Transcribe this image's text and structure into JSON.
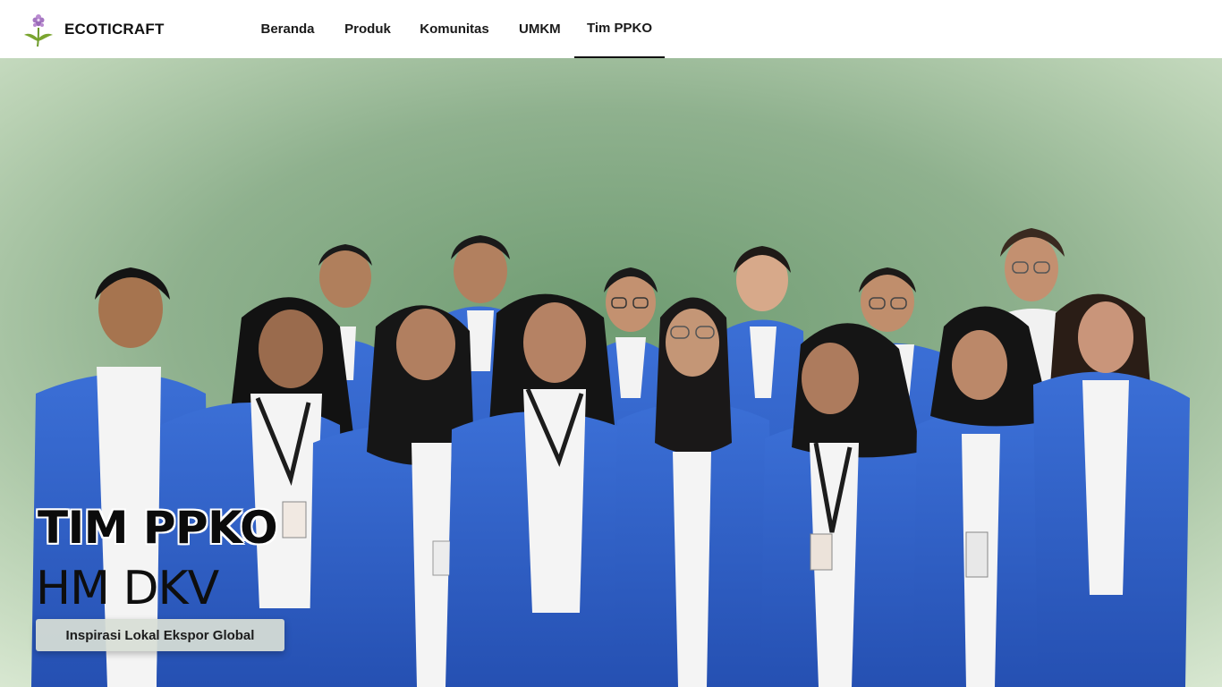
{
  "brand": {
    "name": "ECOTICRAFT",
    "logo_icon": "orchid-flower-icon"
  },
  "nav": {
    "items": [
      {
        "label": "Beranda",
        "active": false
      },
      {
        "label": "Produk",
        "active": false
      },
      {
        "label": "Komunitas",
        "active": false
      },
      {
        "label": "UMKM",
        "active": false
      },
      {
        "label": "Tim PPKO",
        "active": true
      }
    ]
  },
  "hero": {
    "title": "TIM PPKO",
    "subtitle": "HM DKV",
    "tagline": "Inspirasi Lokal Ekspor Global"
  },
  "colors": {
    "jacket_blue": "#2f5fc7",
    "background_green": "#7aa47c",
    "nav_text": "#1a1a1a",
    "active_underline": "#111111"
  }
}
